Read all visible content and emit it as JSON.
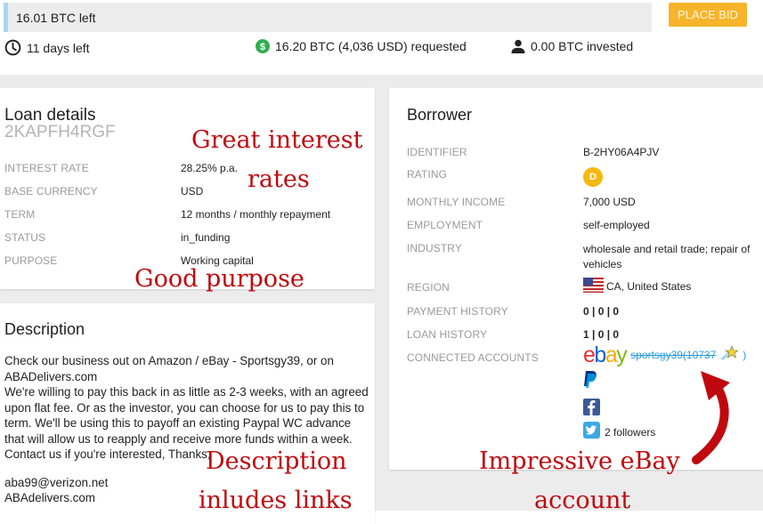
{
  "top": {
    "remaining": "16.01 BTC left",
    "place_bid": "PLACE BID",
    "days_left": "11 days left",
    "requested": "16.20 BTC (4,036 USD) requested",
    "invested": "0.00 BTC invested"
  },
  "loan": {
    "title": "Loan details",
    "id": "2KAPFH4RGF",
    "rows": [
      {
        "label": "INTEREST RATE",
        "value": "28.25% p.a."
      },
      {
        "label": "BASE CURRENCY",
        "value": "USD"
      },
      {
        "label": "TERM",
        "value": "12 months / monthly repayment"
      },
      {
        "label": "STATUS",
        "value": "in_funding"
      },
      {
        "label": "PURPOSE",
        "value": "Working capital"
      }
    ]
  },
  "description": {
    "title": "Description",
    "paragraphs": [
      "Check our business out on Amazon / eBay - Sportsgy39, or on ABADelivers.com",
      "We're willing to pay this back in as little as 2-3 weeks, with an agreed upon flat fee. Or as the investor, you can choose for us to pay this to term. We'll be using this to payoff an existing Paypal WC advance that will allow us to reapply and receive more funds within a week. Contact us if you're interested, Thanks,"
    ],
    "email": "aba99@verizon.net",
    "website": "ABAdelivers.com"
  },
  "borrower": {
    "title": "Borrower",
    "identifier_label": "IDENTIFIER",
    "identifier": "B-2HY06A4PJV",
    "rating_label": "RATING",
    "rating": "D",
    "income_label": "MONTHLY INCOME",
    "income": "7,000 USD",
    "employment_label": "EMPLOYMENT",
    "employment": "self-employed",
    "industry_label": "INDUSTRY",
    "industry": "wholesale and retail trade; repair of vehicles",
    "region_label": "REGION",
    "region": "CA, United States",
    "payment_history_label": "PAYMENT HISTORY",
    "payment_history": "0 | 0 | 0",
    "loan_history_label": "LOAN HISTORY",
    "loan_history": "1 | 0 | 0",
    "connected_label": "CONNECTED ACCOUNTS",
    "ebay_user": "sportsgy39(10737",
    "ebay_close": ")",
    "twitter_followers": "2 followers"
  },
  "annotations": {
    "interest_1": "Great interest",
    "interest_2": "rates",
    "purpose": "Good purpose",
    "desc_1": "Description",
    "desc_2": "inludes links",
    "ebay_1": "Impressive eBay",
    "ebay_2": "account"
  },
  "colors": {
    "accent_orange": "#f7b42b",
    "link_blue": "#2a9ce0",
    "annotation_red": "#c0090d",
    "rating_yellow": "#f6b80e"
  }
}
